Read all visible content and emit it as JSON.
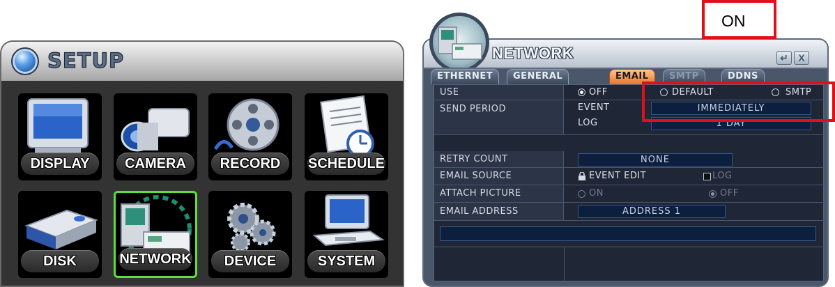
{
  "setup": {
    "title": "SETUP",
    "tiles": [
      {
        "label": "DISPLAY",
        "icon": "display-icon"
      },
      {
        "label": "CAMERA",
        "icon": "camera-icon"
      },
      {
        "label": "RECORD",
        "icon": "record-icon"
      },
      {
        "label": "SCHEDULE",
        "icon": "schedule-icon"
      },
      {
        "label": "DISK",
        "icon": "disk-icon"
      },
      {
        "label": "NETWORK",
        "icon": "network-icon",
        "selected": true
      },
      {
        "label": "DEVICE",
        "icon": "device-icon"
      },
      {
        "label": "SYSTEM",
        "icon": "system-icon"
      }
    ]
  },
  "network": {
    "title": "NETWORK",
    "buttons": {
      "enter": "↵",
      "close": "X"
    },
    "tabs": [
      {
        "label": "ETHERNET"
      },
      {
        "label": "GENERAL"
      },
      {
        "label": "EMAIL",
        "active": true
      },
      {
        "label": "SMTP",
        "disabled": true
      },
      {
        "label": "DDNS"
      }
    ],
    "use": {
      "label": "USE",
      "options": [
        "OFF",
        "DEFAULT",
        "SMTP"
      ],
      "selected": "OFF"
    },
    "send_period": {
      "label": "SEND PERIOD",
      "event_label": "EVENT",
      "event_value": "IMMEDIATELY",
      "log_label": "LOG",
      "log_value": "1 DAY"
    },
    "retry_count": {
      "label": "RETRY COUNT",
      "value": "NONE"
    },
    "email_source": {
      "label": "EMAIL SOURCE",
      "event_edit": "EVENT EDIT",
      "log": "LOG"
    },
    "attach_picture": {
      "label": "ATTACH PICTURE",
      "on": "ON",
      "off": "OFF",
      "selected": "OFF"
    },
    "email_address": {
      "label": "EMAIL ADDRESS",
      "value": "ADDRESS 1",
      "entry": ""
    }
  },
  "annotation": {
    "text": "ON",
    "color": "#e0101b"
  },
  "colors": {
    "selected_tile_border": "#59e03b",
    "active_tab": "#e8742e"
  }
}
